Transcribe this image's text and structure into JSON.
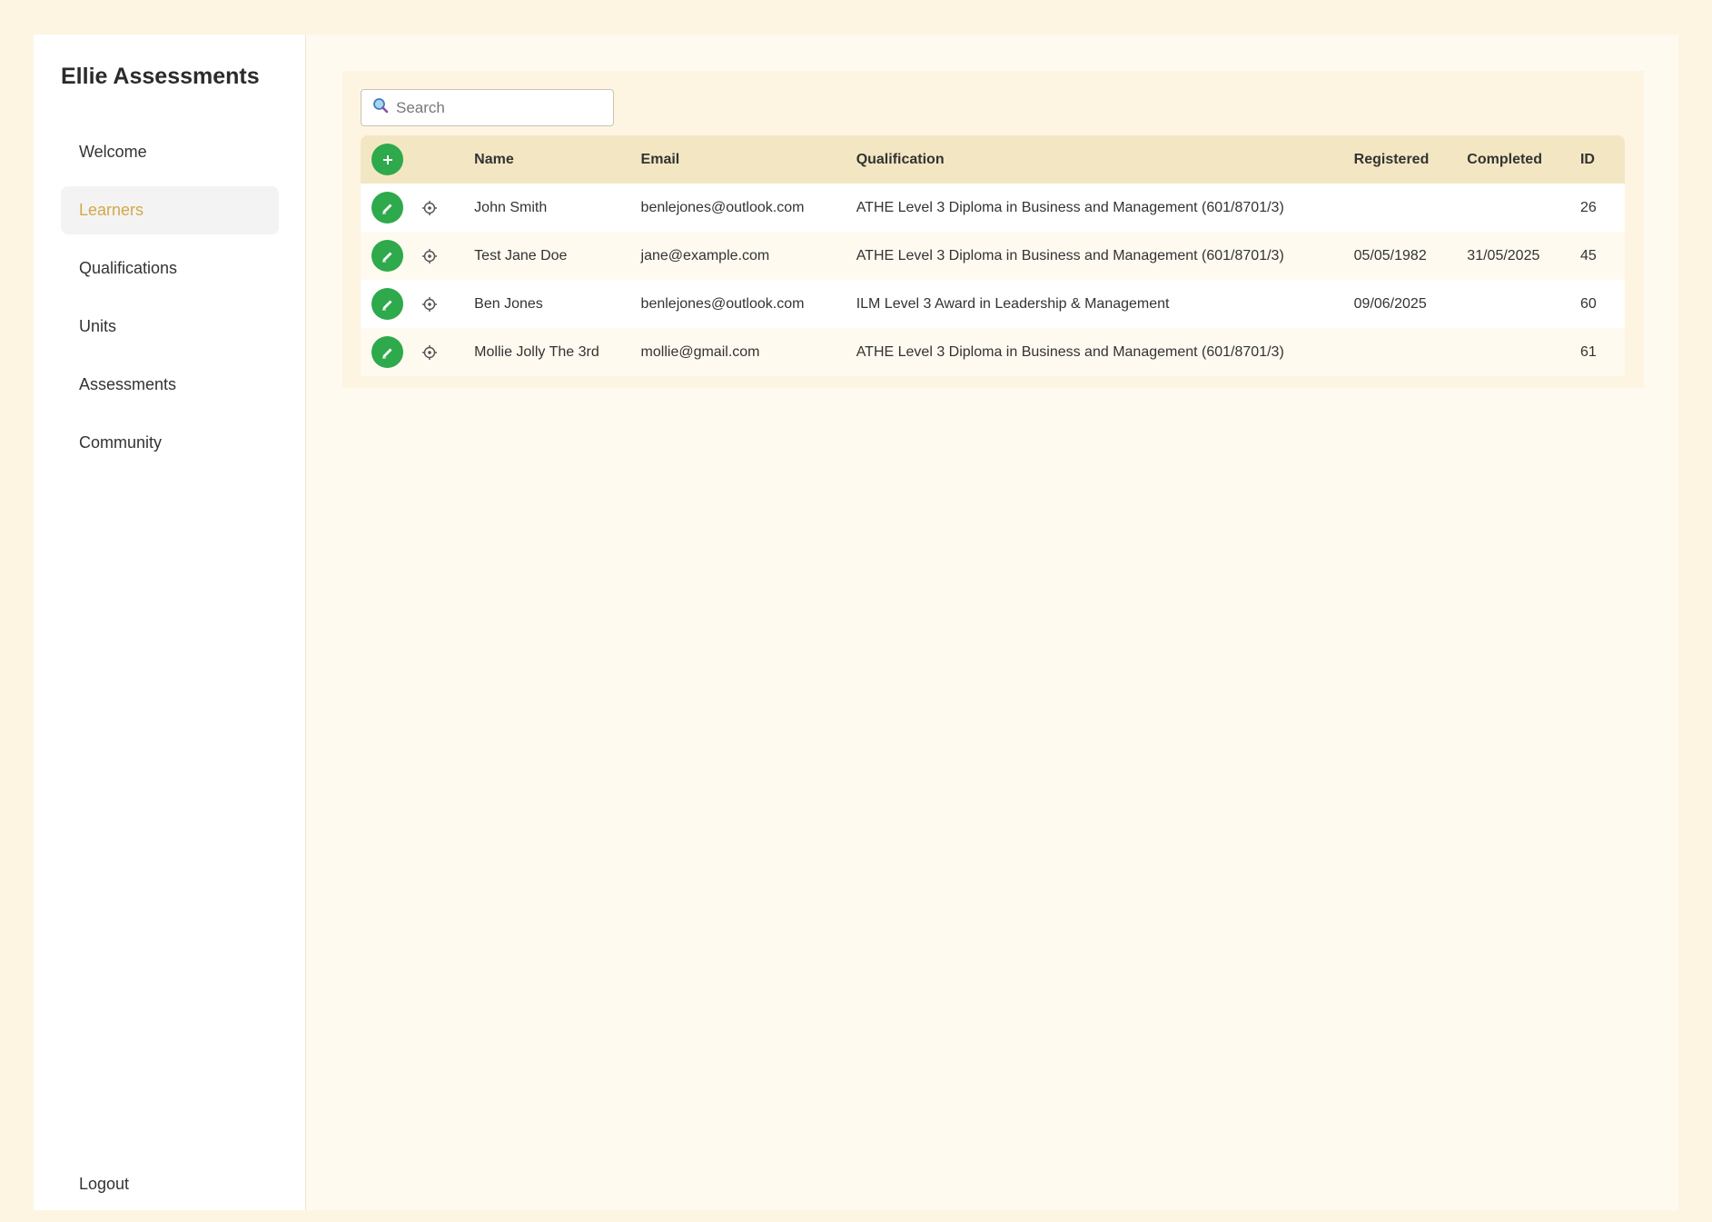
{
  "app": {
    "brand": "Ellie Assessments"
  },
  "sidebar": {
    "items": [
      {
        "label": "Welcome"
      },
      {
        "label": "Learners"
      },
      {
        "label": "Qualifications"
      },
      {
        "label": "Units"
      },
      {
        "label": "Assessments"
      },
      {
        "label": "Community"
      }
    ],
    "active_index": 1,
    "logout_label": "Logout"
  },
  "search": {
    "placeholder": "Search",
    "value": ""
  },
  "table": {
    "columns": [
      "Name",
      "Email",
      "Qualification",
      "Registered",
      "Completed",
      "ID"
    ],
    "rows": [
      {
        "name": "John Smith",
        "email": "benlejones@outlook.com",
        "qualification": "ATHE Level 3 Diploma in Business and Management (601/8701/3)",
        "registered": "",
        "completed": "",
        "id": "26"
      },
      {
        "name": "Test Jane Doe",
        "email": "jane@example.com",
        "qualification": "ATHE Level 3 Diploma in Business and Management (601/8701/3)",
        "registered": "05/05/1982",
        "completed": "31/05/2025",
        "id": "45"
      },
      {
        "name": "Ben Jones",
        "email": "benlejones@outlook.com",
        "qualification": "ILM Level 3 Award in Leadership & Management",
        "registered": "09/06/2025",
        "completed": "",
        "id": "60"
      },
      {
        "name": "Mollie Jolly The 3rd",
        "email": "mollie@gmail.com",
        "qualification": "ATHE Level 3 Diploma in Business and Management (601/8701/3)",
        "registered": "",
        "completed": "",
        "id": "61"
      }
    ]
  },
  "colors": {
    "accent_green": "#2ea94b",
    "active_nav_text": "#d4a84a",
    "header_bg": "#f3e7c3",
    "page_bg": "#fdf5e2"
  },
  "icons": {
    "add": "plus-icon",
    "edit": "pencil-icon",
    "settings": "gear-icon",
    "search": "search-icon"
  }
}
